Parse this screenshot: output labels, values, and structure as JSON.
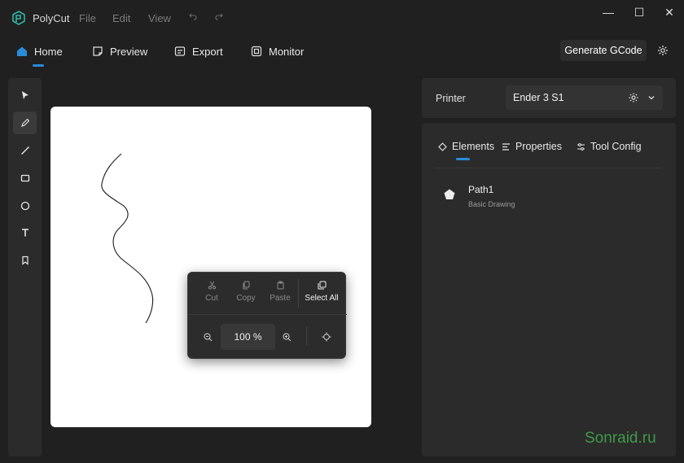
{
  "app": {
    "title": "PolyCut"
  },
  "menu": {
    "file": "File",
    "edit": "Edit",
    "view": "View"
  },
  "window": {
    "minimize": "—",
    "maximize": "☐",
    "close": "✕"
  },
  "nav": {
    "tabs": [
      {
        "label": "Home",
        "icon": "home-icon"
      },
      {
        "label": "Preview",
        "icon": "preview-icon"
      },
      {
        "label": "Export",
        "icon": "export-icon"
      },
      {
        "label": "Monitor",
        "icon": "monitor-icon"
      }
    ],
    "generate_label": "Generate GCode"
  },
  "tools": [
    {
      "name": "select-tool",
      "icon": "cursor-icon"
    },
    {
      "name": "pen-tool",
      "icon": "pen-icon",
      "active": true
    },
    {
      "name": "line-tool",
      "icon": "line-icon"
    },
    {
      "name": "rectangle-tool",
      "icon": "rectangle-icon"
    },
    {
      "name": "ellipse-tool",
      "icon": "ellipse-icon"
    },
    {
      "name": "text-tool",
      "icon": "text-icon"
    },
    {
      "name": "bookmark-tool",
      "icon": "bookmark-icon"
    }
  ],
  "popup": {
    "actions": [
      {
        "label": "Cut",
        "icon": "cut-icon",
        "enabled": false
      },
      {
        "label": "Copy",
        "icon": "copy-icon",
        "enabled": false
      },
      {
        "label": "Paste",
        "icon": "paste-icon",
        "enabled": false
      },
      {
        "label": "Select All",
        "icon": "select-all-icon",
        "enabled": true
      }
    ],
    "zoom_value": "100 %"
  },
  "printer": {
    "label": "Printer",
    "selected": "Ender 3 S1"
  },
  "side_panel": {
    "tabs": [
      {
        "label": "Elements",
        "icon": "elements-icon"
      },
      {
        "label": "Properties",
        "icon": "properties-icon"
      },
      {
        "label": "Tool Config",
        "icon": "tool-config-icon"
      }
    ],
    "elements": [
      {
        "name": "Path1",
        "type": "Basic Drawing",
        "icon": "pentagon-icon"
      }
    ]
  },
  "watermark": "Sonraid.ru",
  "colors": {
    "accent": "#2a8bd8",
    "background": "#202020",
    "panel": "#2b2b2b",
    "canvas": "#ffffff"
  }
}
